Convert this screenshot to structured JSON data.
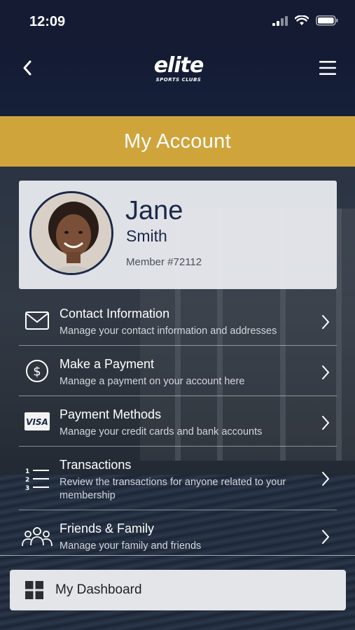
{
  "status_bar": {
    "time": "12:09"
  },
  "header": {
    "logo_main": "elite",
    "logo_sub": "SPORTS CLUBS",
    "back_icon": "chevron-left-icon",
    "menu_icon": "hamburger-menu-icon"
  },
  "page": {
    "title": "My Account"
  },
  "profile": {
    "first_name": "Jane",
    "last_name": "Smith",
    "member_label": "Member #72112"
  },
  "menu": {
    "items": [
      {
        "title": "Contact Information",
        "description": "Manage your contact information and addresses",
        "icon": "envelope-icon"
      },
      {
        "title": "Make a Payment",
        "description": "Manage a payment on your account here",
        "icon": "dollar-circle-icon"
      },
      {
        "title": "Payment Methods",
        "description": "Manage your credit cards and bank accounts",
        "icon": "visa-card-icon",
        "icon_text": "VISA"
      },
      {
        "title": "Transactions",
        "description": "Review the transactions for anyone related to your membership",
        "icon": "numbered-list-icon"
      },
      {
        "title": "Friends & Family",
        "description": "Manage your family and friends",
        "icon": "people-group-icon"
      }
    ]
  },
  "dashboard_button": {
    "label": "My Dashboard",
    "icon": "grid-icon"
  },
  "colors": {
    "accent_gold": "#cfa43b",
    "navy": "#141b33",
    "text_navy": "#1d2848"
  }
}
